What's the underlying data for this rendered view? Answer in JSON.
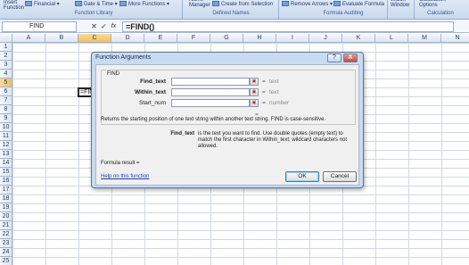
{
  "ribbon": {
    "insert_function": "Insert\nFunction",
    "financial": "Financial",
    "date_time": "Date & Time",
    "more_functions": "More Functions",
    "function_library": "Function Library",
    "name_manager": "Name\nManager",
    "create_from_selection": "Create from Selection",
    "defined_names": "Defined Names",
    "remove_arrows": "Remove Arrows",
    "evaluate_formula": "Evaluate Formula",
    "formula_auditing": "Formula Auditing",
    "watch_window": "Watch\nWindow",
    "calculation_options": "Calculation\nOptions",
    "calculation": "Calculation"
  },
  "formula_bar": {
    "name_box": "FIND",
    "cancel": "✕",
    "enter": "✓",
    "fx": "fx",
    "formula": "=FIND()"
  },
  "grid": {
    "columns": [
      "A",
      "B",
      "C",
      "D",
      "E",
      "F",
      "G",
      "H",
      "I",
      "J",
      "K",
      "L",
      "M",
      "N"
    ],
    "rows": [
      "1",
      "2",
      "3",
      "4",
      "5",
      "6",
      "7",
      "8",
      "9",
      "10",
      "11",
      "12",
      "13",
      "14",
      "15",
      "16",
      "17",
      "18",
      "19",
      "20",
      "21",
      "22",
      "23",
      "24",
      "25"
    ],
    "active_cell_content": "=FIND()"
  },
  "dialog": {
    "title": "Function Arguments",
    "help_button": "?",
    "close_button": "X",
    "function_name": "FIND",
    "args": [
      {
        "label": "Find_text",
        "type": "text",
        "bold": true
      },
      {
        "label": "Within_text",
        "type": "text",
        "bold": true
      },
      {
        "label": "Start_num",
        "type": "number",
        "bold": false
      }
    ],
    "equals": "=",
    "description": "Returns the starting position of one text string within another text string. FIND is case-sensitive.",
    "arg_help_name": "Find_text",
    "arg_help_text": "is the text you want to find. Use double quotes (empty text) to match the first character in Within_text; wildcard characters not allowed.",
    "formula_result": "Formula result =",
    "help_link": "Help on this function",
    "ok": "OK",
    "cancel": "Cancel"
  }
}
